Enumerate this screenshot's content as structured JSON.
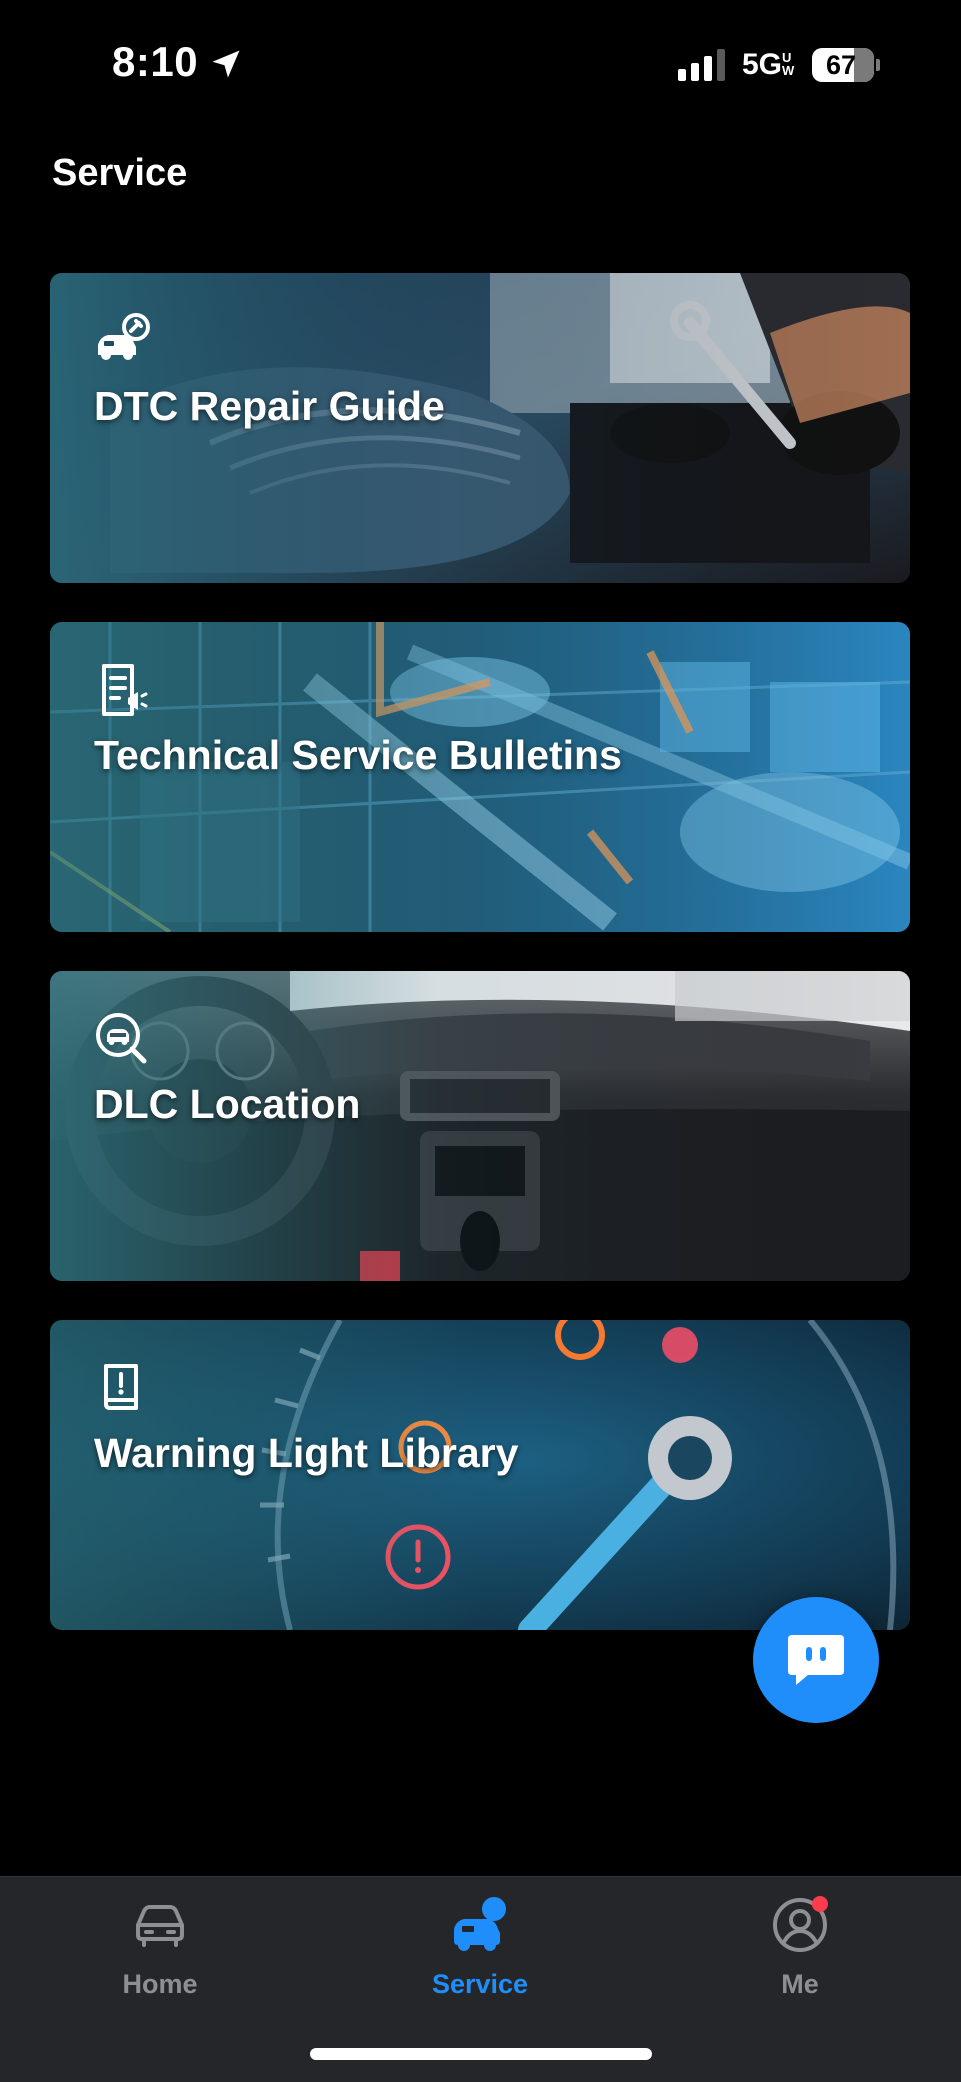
{
  "status_bar": {
    "time": "8:10",
    "network": "5G",
    "network_suffix": "UW",
    "battery": "67"
  },
  "page": {
    "title": "Service"
  },
  "cards": [
    {
      "label": "DTC Repair Guide",
      "icon": "car-wrench-icon"
    },
    {
      "label": "Technical Service Bulletins",
      "icon": "bulletin-document-icon"
    },
    {
      "label": "DLC Location",
      "icon": "car-search-icon"
    },
    {
      "label": "Warning Light Library",
      "icon": "warning-book-icon"
    }
  ],
  "chat": {
    "icon": "chat-bubble-icon"
  },
  "tabbar": {
    "tabs": [
      {
        "label": "Home",
        "icon": "car-icon",
        "active": false
      },
      {
        "label": "Service",
        "icon": "service-icon",
        "active": true
      },
      {
        "label": "Me",
        "icon": "profile-icon",
        "active": false,
        "badge": true
      }
    ]
  },
  "colors": {
    "accent": "#1f8efa",
    "background": "#000000",
    "tabbar": "#25262a",
    "inactive_tab": "#8e8f94",
    "badge": "#ff3b4e"
  }
}
